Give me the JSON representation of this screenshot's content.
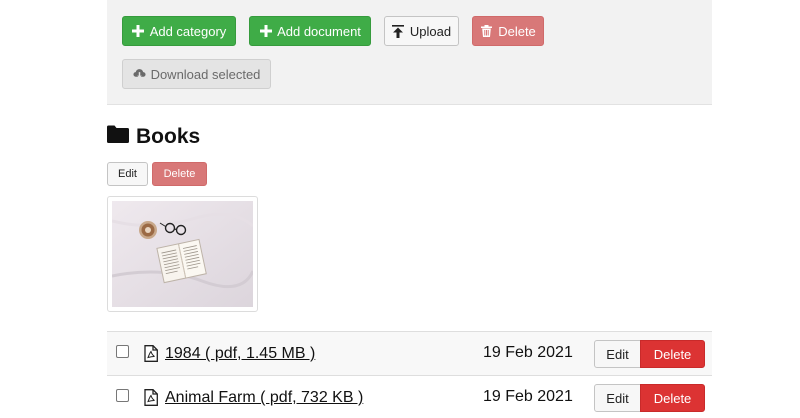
{
  "toolbar": {
    "add_category_label": "Add category",
    "add_document_label": "Add document",
    "upload_label": "Upload",
    "delete_label": "Delete",
    "download_selected_label": "Download selected"
  },
  "category": {
    "icon": "folder-icon",
    "title": "Books",
    "edit_label": "Edit",
    "delete_label": "Delete"
  },
  "documents": [
    {
      "name": "1984 ( pdf, 1.45 MB )",
      "date": "19 Feb 2021",
      "edit_label": "Edit",
      "delete_label": "Delete"
    },
    {
      "name": "Animal Farm ( pdf, 732 KB )",
      "date": "19 Feb 2021",
      "edit_label": "Edit",
      "delete_label": "Delete"
    }
  ],
  "colors": {
    "green": "#3fac47",
    "faded_red": "#d87878",
    "red": "#dc3333",
    "panel": "#f2f2f2"
  }
}
